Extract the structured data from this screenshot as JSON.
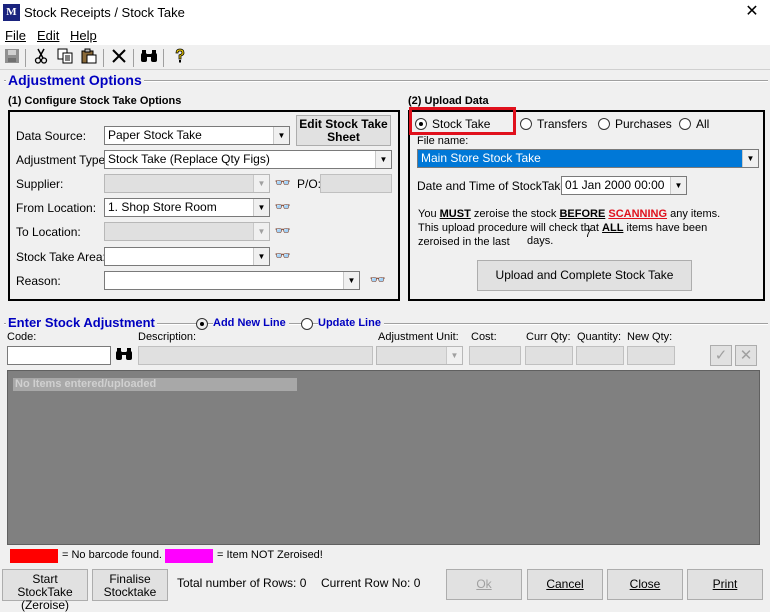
{
  "window": {
    "title": "Stock Receipts / Stock Take",
    "icon_letter": "M",
    "close_glyph": "✕"
  },
  "menu": {
    "items": [
      {
        "label": "File"
      },
      {
        "label": "Edit"
      },
      {
        "label": "Help"
      }
    ]
  },
  "toolbar": {
    "icons": [
      "save-icon",
      "cut-icon",
      "copy-icon",
      "paste-icon",
      "delete-icon",
      "find-icon",
      "help-icon"
    ]
  },
  "adjustment_options": {
    "title": "Adjustment Options",
    "configure": {
      "heading": "(1) Configure Stock Take Options",
      "data_source_label": "Data Source:",
      "data_source_value": "Paper Stock Take",
      "edit_button_line1": "Edit Stock Take",
      "edit_button_line2": "Sheet",
      "adjustment_type_label": "Adjustment Type:",
      "adjustment_type_value": "Stock Take (Replace Qty Figs)",
      "supplier_label": "Supplier:",
      "supplier_value": "",
      "po_label": "P/O:",
      "po_value": "",
      "from_location_label": "From Location:",
      "from_location_value": "1. Shop Store Room",
      "to_location_label": "To  Location:",
      "to_location_value": "",
      "stock_take_area_label": "Stock Take Area:",
      "stock_take_area_value": "",
      "reason_label": "Reason:",
      "reason_value": ""
    },
    "upload": {
      "heading": "(2) Upload Data",
      "radio_stock_take": "Stock Take",
      "radio_transfers": "Transfers",
      "radio_purchases": "Purchases",
      "radio_all": "All",
      "file_name_label": "File name:",
      "file_name_value": "Main Store Stock Take",
      "datetime_label": "Date and Time of StockTake:",
      "datetime_value": "01 Jan  2000 00:00",
      "note_you": "You ",
      "note_must": "MUST",
      "note_zeroise": " zeroise the stock ",
      "note_before": "BEFORE",
      "note_scanning": "SCANNING",
      "note_any": " any items.",
      "note_line2a": "This upload procedure will check that ",
      "note_all": "ALL",
      "note_line2b": " items have been",
      "note_line3a": "zeroised in the last",
      "note_days_value": "7",
      "note_line3b": "days.",
      "upload_button": "Upload and Complete Stock Take"
    }
  },
  "enter_adjustment": {
    "title": "Enter Stock Adjustment",
    "radio_add": "Add New Line",
    "radio_update": "Update Line",
    "code_label": "Code:",
    "description_label": "Description:",
    "adjustment_unit_label": "Adjustment Unit:",
    "cost_label": "Cost:",
    "curr_qty_label": "Curr Qty:",
    "quantity_label": "Quantity:",
    "new_qty_label": "New Qty:",
    "confirm_glyph": "✓",
    "cancel_glyph": "✕",
    "empty_message": "No Items entered/uploaded"
  },
  "legend": {
    "red_color": "#ff0000",
    "red_text": "= No barcode found.",
    "magenta_color": "#ff00ff",
    "magenta_text": "= Item NOT Zeroised!"
  },
  "footer": {
    "start_line1": "Start StockTake",
    "start_line2": "(Zeroise)",
    "finalise_line1": "Finalise",
    "finalise_line2": "Stocktake",
    "total_rows_label": "Total number of Rows:",
    "total_rows_value": "0",
    "current_row_label": "Current Row No:",
    "current_row_value": "0",
    "ok_label": "Ok",
    "cancel_label": "Cancel",
    "close_label": "Close",
    "print_label": "Print"
  },
  "colors": {
    "accent_blue": "#0000c0",
    "highlight_box": "#e0101c",
    "selection": "#0078d7"
  }
}
